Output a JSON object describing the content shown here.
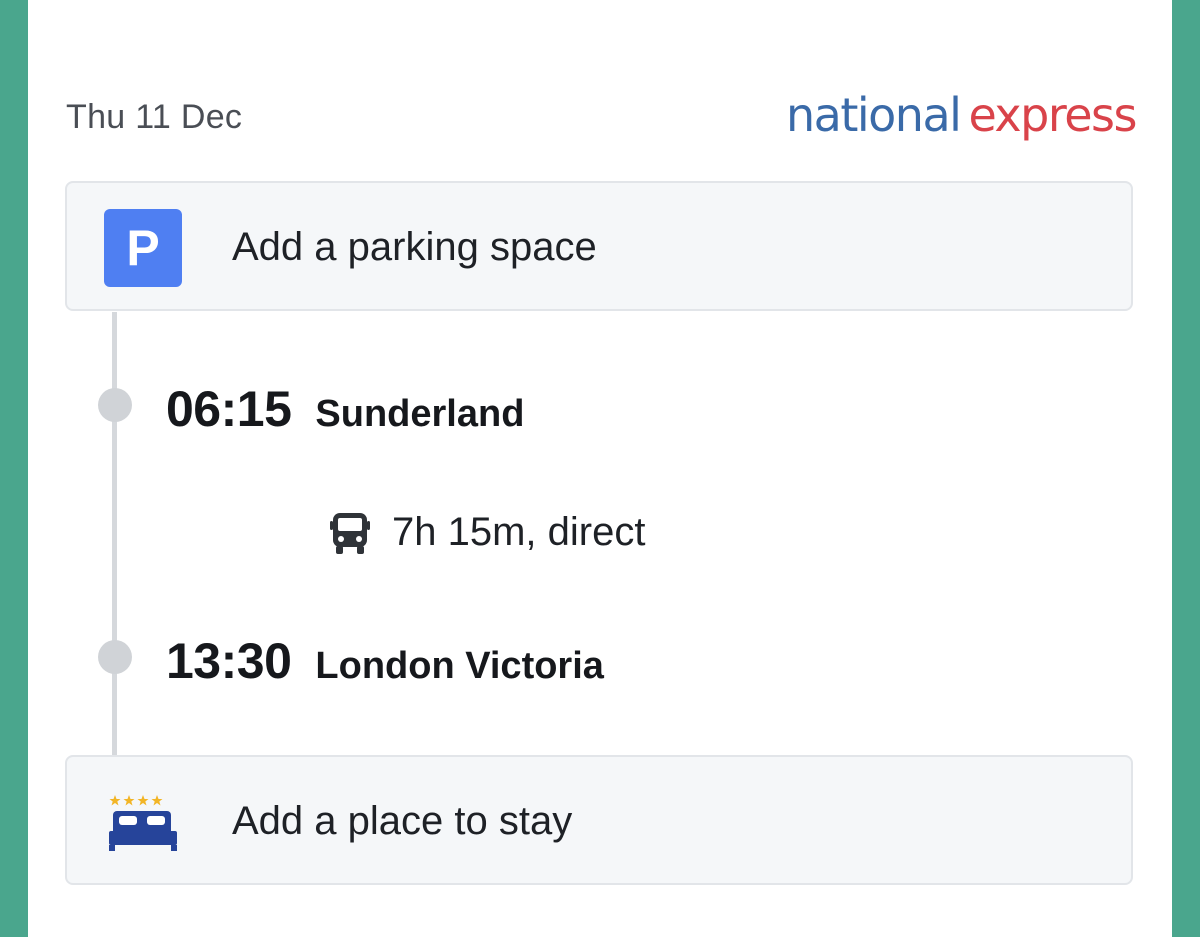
{
  "header": {
    "date": "Thu 11 Dec",
    "brand_part1": "national",
    "brand_part2": "express"
  },
  "parking": {
    "icon_letter": "P",
    "label": "Add a parking space",
    "icon": "parking-icon"
  },
  "journey": {
    "departure": {
      "time": "06:15",
      "place": "Sunderland"
    },
    "duration": {
      "text": "7h 15m, direct",
      "icon": "bus-icon"
    },
    "arrival": {
      "time": "13:30",
      "place": "London Victoria"
    }
  },
  "stay": {
    "label": "Add a place to stay",
    "icon": "bed-icon"
  },
  "colors": {
    "background": "#4aa68d",
    "brand_blue": "#3a6aa8",
    "brand_red": "#d9434a",
    "parking_blue": "#4f7ff2",
    "bed_navy": "#26449a",
    "stars": "#f2b526"
  }
}
